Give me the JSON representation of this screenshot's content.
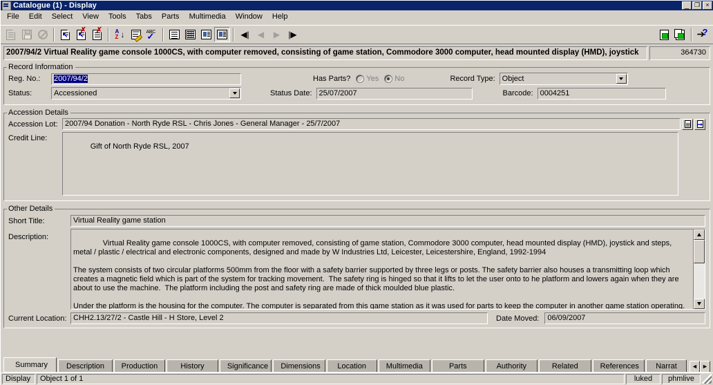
{
  "window": {
    "title": "Catalogue (1) - Display",
    "icon": "catalogue-icon",
    "minimize": "_",
    "maximize": "❐",
    "close": "×"
  },
  "menu": [
    "File",
    "Edit",
    "Select",
    "View",
    "Tools",
    "Tabs",
    "Parts",
    "Multimedia",
    "Window",
    "Help"
  ],
  "toolbar": {
    "groups": [
      [
        "new-record",
        "save-record",
        "no-entry"
      ],
      [
        "insert-record",
        "delete-record",
        "cut-record"
      ],
      [
        "sort-az",
        "edit-note",
        "spell-check"
      ],
      [
        "list-view",
        "grid-view",
        "page-view",
        "details-view"
      ],
      [
        "first-record",
        "previous-record",
        "next-record",
        "last-record"
      ]
    ],
    "right": [
      "copy-record",
      "duplicate-record",
      "context-help"
    ]
  },
  "header": {
    "title": "2007/94/2 Virtual Reality game console 1000CS, with computer removed, consisting of game station, Commodore 3000 computer, head mounted display (HMD), joystick",
    "number": "364730"
  },
  "record_information": {
    "legend": "Record Information",
    "reg_no_label": "Reg. No.:",
    "reg_no_value": "2007/94/2",
    "reg_no_selected": true,
    "status_label": "Status:",
    "status_value": "Accessioned",
    "has_parts_label": "Has Parts?",
    "has_parts_yes": "Yes",
    "has_parts_no": "No",
    "has_parts_selected": "No",
    "status_date_label": "Status Date:",
    "status_date_value": "25/07/2007",
    "record_type_label": "Record Type:",
    "record_type_value": "Object",
    "barcode_label": "Barcode:",
    "barcode_value": "0004251"
  },
  "accession_details": {
    "legend": "Accession Details",
    "accession_lot_label": "Accession Lot:",
    "accession_lot_value": "2007/94 Donation - North Ryde RSL - Chris Jones - General Manager - 25/7/2007",
    "credit_line_label": "Credit Line:",
    "credit_line_value": "Gift of North Ryde RSL, 2007",
    "attach_button": "attach-lot-icon",
    "goto_button": "goto-lot-icon"
  },
  "other_details": {
    "legend": "Other Details",
    "short_title_label": "Short Title:",
    "short_title_value": "Virtual Reality game station",
    "description_label": "Description:",
    "description_value": "Virtual Reality game console 1000CS, with computer removed, consisting of game station, Commodore 3000 computer, head mounted display (HMD), joystick and steps, metal / plastic / electrical and electronic components, designed and made by W Industries Ltd, Leicester, Leicestershire, England, 1992-1994\n\nThe system consists of two circular platforms 500mm from the floor with a safety barrier supported by three legs or posts. The safety barrier also houses a transmitting loop which creates a magnetic field which is part of the system for tracking movement.  The safety ring is hinged so that it lifts to let the user onto to he platform and lowers again when they are about to use the machine.  The platform including the post and safety ring are made of thick moulded blue plastic.\n\nUnder the platform is the housing for the computer. The computer is separated from this game station as it was used for parts to keep the computer in another game station operating. The computer has a cream coloured hard plastic exterior with a floppy disk-drive slot at the front of the unit, and inputs and outputs for linking to peripherals at the rear.",
    "current_location_label": "Current Location:",
    "current_location_value": "CHH2.13/27/2 - Castle Hill - H Store, Level 2",
    "date_moved_label": "Date Moved:",
    "date_moved_value": "06/09/2007"
  },
  "tabs": {
    "items": [
      {
        "label": "Summary",
        "active": true
      },
      {
        "label": "Description",
        "active": false
      },
      {
        "label": "Production",
        "active": false
      },
      {
        "label": "History",
        "active": false
      },
      {
        "label": "Significance",
        "active": false
      },
      {
        "label": "Dimensions",
        "active": false
      },
      {
        "label": "Location",
        "active": false
      },
      {
        "label": "Multimedia",
        "active": false
      },
      {
        "label": "Parts",
        "active": false
      },
      {
        "label": "Authority",
        "active": false
      },
      {
        "label": "Related",
        "active": false
      },
      {
        "label": "References",
        "active": false
      },
      {
        "label": "Narrat",
        "active": false
      }
    ],
    "scroll_left": "◄",
    "scroll_right": "►"
  },
  "statusbar": {
    "mode": "Display",
    "record_position": "Object 1 of 1",
    "user": "luked",
    "server": "phmlive"
  },
  "colors": {
    "titlebar": "#0a246a",
    "face": "#d4d0c8",
    "selection": "#000080",
    "shadow": "#808080"
  }
}
